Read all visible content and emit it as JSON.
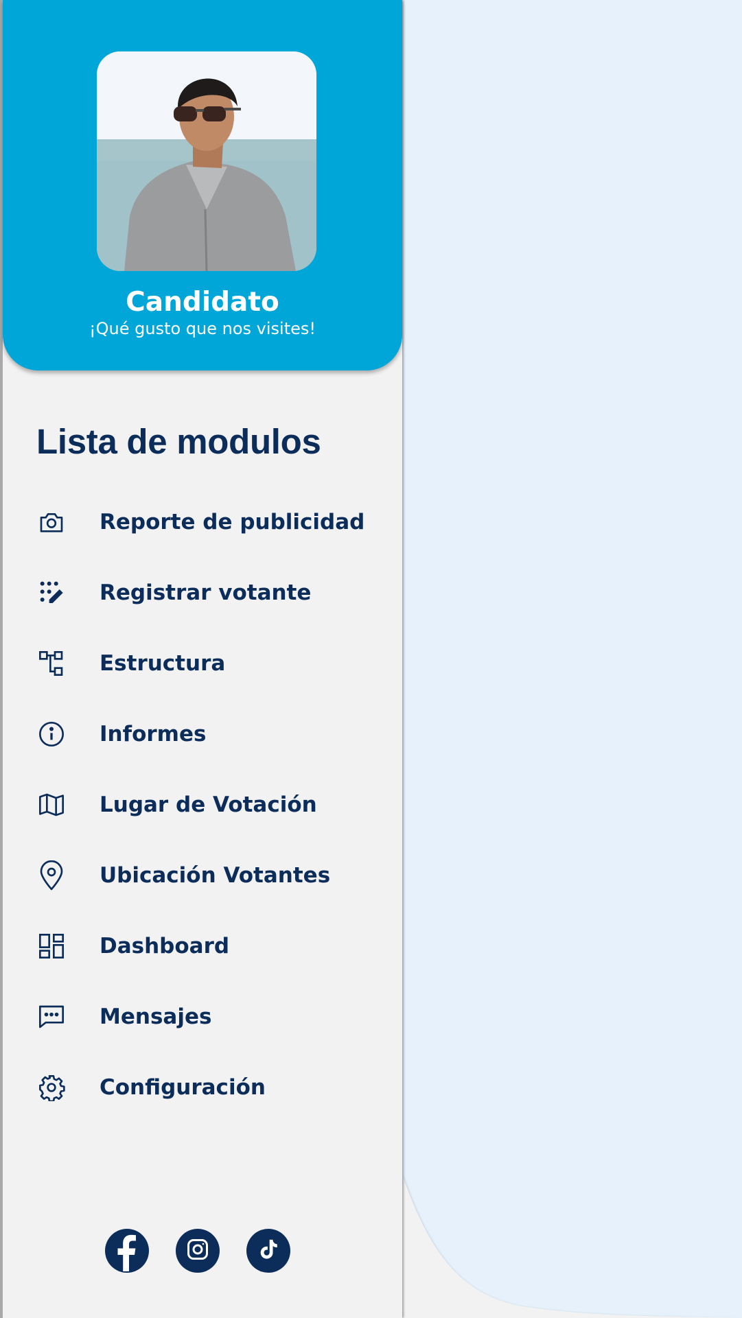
{
  "profile": {
    "name": "Candidato",
    "greeting": "¡Qué gusto que nos visites!",
    "avatar_icon": "profile-photo"
  },
  "menu": {
    "title": "Lista de modulos",
    "items": [
      {
        "label": "Reporte de publicidad",
        "icon": "camera-icon"
      },
      {
        "label": "Registrar votante",
        "icon": "dots-pen-icon"
      },
      {
        "label": "Estructura",
        "icon": "hierarchy-icon"
      },
      {
        "label": "Informes",
        "icon": "info-icon"
      },
      {
        "label": "Lugar de Votación",
        "icon": "map-icon"
      },
      {
        "label": "Ubicación Votantes",
        "icon": "location-pin-icon"
      },
      {
        "label": "Dashboard",
        "icon": "dashboard-icon"
      },
      {
        "label": "Mensajes",
        "icon": "message-icon"
      },
      {
        "label": "Configuración",
        "icon": "gear-icon"
      }
    ]
  },
  "social": [
    {
      "name": "Facebook",
      "icon": "facebook-icon"
    },
    {
      "name": "Instagram",
      "icon": "instagram-icon"
    },
    {
      "name": "TikTok",
      "icon": "tiktok-icon"
    }
  ],
  "colors": {
    "primary": "#00a6d8",
    "navy": "#0c2d5a",
    "drawer_bg": "#f2f2f2",
    "page_bg": "#e6f1fb"
  }
}
